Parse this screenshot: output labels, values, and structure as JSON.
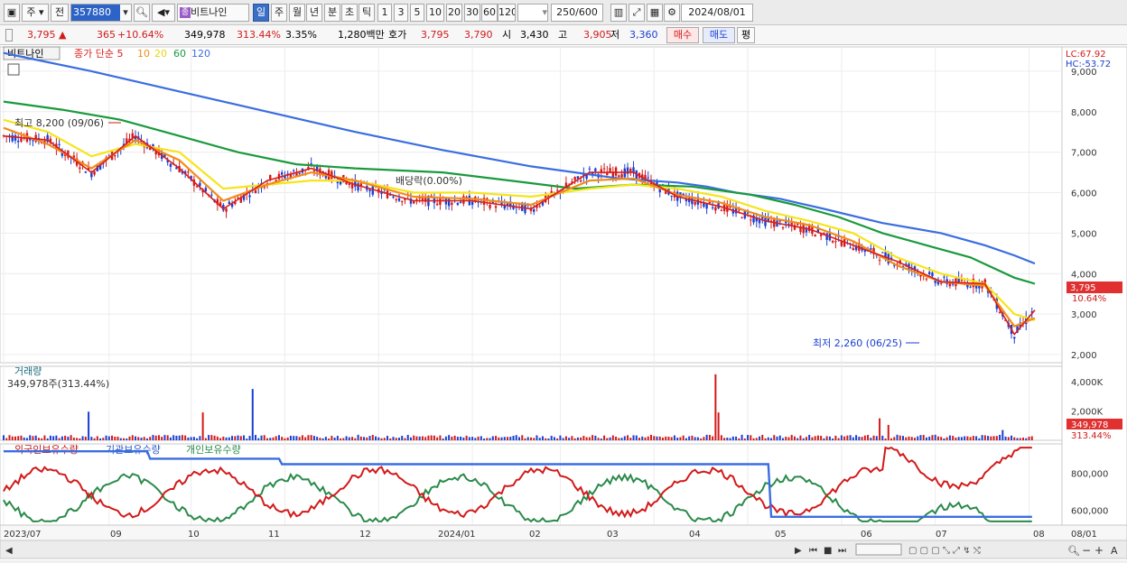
{
  "toolbar": {
    "type_label": "주",
    "period_label": "전",
    "stock_code": "357880",
    "stock_name": "비트나인",
    "tab_day": "일",
    "tab_week": "주",
    "tab_month": "월",
    "tab_year": "년",
    "tab_minute": "분",
    "tab_second": "초",
    "tab_tick": "틱",
    "intervals": [
      "1",
      "3",
      "5",
      "10",
      "20",
      "30",
      "60",
      "120"
    ],
    "count": "250",
    "count_max": "/600",
    "date": "2024/08/01"
  },
  "infobar": {
    "price": "3,795",
    "change": "365",
    "change_pct": "+10.64%",
    "volume": "349,978",
    "volume_ratio": "313.44%",
    "turnover": "3.35%",
    "amount": "1,280백만",
    "quote_label": "호가",
    "bid": "3,795",
    "ask": "3,790",
    "open_label": "시",
    "open": "3,430",
    "high_label": "고",
    "high": "3,905",
    "low_label": "저",
    "low": "3,360",
    "buy": "매수",
    "sell": "매도",
    "avg": "평"
  },
  "colors": {
    "ma5": "#d81e1e",
    "ma10": "#f28c1a",
    "ma20": "#f5e51a",
    "ma60": "#1a9a3c",
    "ma120": "#3a6ee0",
    "up": "#d21a1a",
    "down": "#1a3fd2"
  },
  "chart_data": [
    {
      "type": "candlestick",
      "title": "비트나인",
      "legend": [
        "종가 단순 5",
        "10",
        "20",
        "60",
        "120"
      ],
      "ylim": [
        1800,
        9600
      ],
      "yticks": [
        2000,
        3000,
        4000,
        5000,
        6000,
        7000,
        8000,
        9000
      ],
      "ytick_labels": [
        "2,000",
        "3,000",
        "4,000",
        "5,000",
        "6,000",
        "7,000",
        "8,000",
        "9,000"
      ],
      "lc": "LC:67.92",
      "hc": "HC:-53.72",
      "high_label": "최고 8,200 (09/06)",
      "low_label": "최저 2,260 (06/25)",
      "div_label": "배당락(0.00%)",
      "last_price": "3,795",
      "last_pct": "10.64%",
      "x_labels": [
        "2023/07",
        "09",
        "10",
        "11",
        "12",
        "2024/01",
        "02",
        "03",
        "04",
        "05",
        "06",
        "07",
        "08",
        "08/01"
      ],
      "ma120": [
        [
          0,
          9450
        ],
        [
          10,
          9300
        ],
        [
          30,
          9000
        ],
        [
          60,
          8500
        ],
        [
          90,
          8000
        ],
        [
          120,
          7500
        ],
        [
          150,
          7050
        ],
        [
          180,
          6650
        ],
        [
          210,
          6350
        ],
        [
          230,
          6250
        ],
        [
          240,
          6150
        ],
        [
          250,
          6000
        ],
        [
          265,
          5850
        ],
        [
          280,
          5600
        ],
        [
          300,
          5250
        ],
        [
          320,
          5000
        ],
        [
          335,
          4700
        ],
        [
          345,
          4450
        ],
        [
          352,
          4250
        ]
      ],
      "ma60": [
        [
          0,
          8250
        ],
        [
          20,
          8050
        ],
        [
          40,
          7800
        ],
        [
          60,
          7400
        ],
        [
          80,
          7000
        ],
        [
          100,
          6700
        ],
        [
          120,
          6600
        ],
        [
          150,
          6500
        ],
        [
          175,
          6280
        ],
        [
          195,
          6100
        ],
        [
          215,
          6200
        ],
        [
          235,
          6150
        ],
        [
          255,
          5950
        ],
        [
          270,
          5700
        ],
        [
          285,
          5400
        ],
        [
          300,
          5000
        ],
        [
          315,
          4700
        ],
        [
          330,
          4400
        ],
        [
          345,
          3900
        ],
        [
          352,
          3750
        ]
      ],
      "ma20": [
        [
          0,
          7800
        ],
        [
          15,
          7500
        ],
        [
          30,
          6900
        ],
        [
          45,
          7200
        ],
        [
          60,
          7000
        ],
        [
          75,
          6100
        ],
        [
          90,
          6200
        ],
        [
          105,
          6300
        ],
        [
          120,
          6300
        ],
        [
          140,
          6000
        ],
        [
          160,
          6000
        ],
        [
          180,
          5900
        ],
        [
          200,
          6100
        ],
        [
          215,
          6200
        ],
        [
          230,
          6100
        ],
        [
          245,
          5900
        ],
        [
          260,
          5550
        ],
        [
          275,
          5300
        ],
        [
          290,
          5000
        ],
        [
          305,
          4400
        ],
        [
          320,
          4000
        ],
        [
          335,
          3750
        ],
        [
          345,
          3000
        ],
        [
          352,
          2850
        ]
      ],
      "ma10": [
        [
          0,
          7600
        ],
        [
          15,
          7200
        ],
        [
          30,
          6600
        ],
        [
          45,
          7300
        ],
        [
          60,
          6800
        ],
        [
          75,
          5800
        ],
        [
          90,
          6200
        ],
        [
          105,
          6500
        ],
        [
          120,
          6300
        ],
        [
          140,
          5900
        ],
        [
          160,
          5850
        ],
        [
          180,
          5700
        ],
        [
          200,
          6300
        ],
        [
          215,
          6350
        ],
        [
          230,
          5950
        ],
        [
          245,
          5750
        ],
        [
          260,
          5400
        ],
        [
          275,
          5200
        ],
        [
          290,
          4800
        ],
        [
          305,
          4200
        ],
        [
          320,
          3800
        ],
        [
          335,
          3700
        ],
        [
          345,
          2700
        ],
        [
          352,
          2900
        ]
      ],
      "ma5": [
        [
          0,
          7400
        ],
        [
          15,
          7300
        ],
        [
          30,
          6500
        ],
        [
          45,
          7400
        ],
        [
          60,
          6600
        ],
        [
          75,
          5600
        ],
        [
          90,
          6300
        ],
        [
          105,
          6600
        ],
        [
          120,
          6200
        ],
        [
          140,
          5800
        ],
        [
          160,
          5800
        ],
        [
          180,
          5600
        ],
        [
          200,
          6500
        ],
        [
          215,
          6500
        ],
        [
          230,
          5900
        ],
        [
          245,
          5650
        ],
        [
          260,
          5300
        ],
        [
          275,
          5100
        ],
        [
          290,
          4700
        ],
        [
          305,
          4300
        ],
        [
          320,
          3800
        ],
        [
          335,
          3750
        ],
        [
          345,
          2500
        ],
        [
          352,
          3100
        ]
      ]
    },
    {
      "type": "bar",
      "title": "거래량",
      "subtitle": "349,978주(313.44%)",
      "yticks": [
        2000,
        4000
      ],
      "ytick_labels": [
        "2,000K",
        "4,000K"
      ],
      "last_value": "349,978",
      "last_pct": "313.44%",
      "ylim": [
        0,
        4800
      ],
      "spikes": [
        [
          38,
          1950
        ],
        [
          72,
          1200
        ],
        [
          90,
          1900
        ],
        [
          112,
          3500
        ],
        [
          180,
          1500
        ],
        [
          320,
          4500
        ],
        [
          322,
          1900
        ],
        [
          394,
          1500
        ],
        [
          398,
          1050
        ],
        [
          425,
          1350
        ],
        [
          450,
          700
        ],
        [
          462,
          820
        ]
      ]
    },
    {
      "type": "line",
      "title": "외국인보유수량",
      "legend": [
        "외국인보유수량",
        "기관보유수량",
        "개인보유수량"
      ],
      "yticks": [
        600000,
        800000
      ],
      "ytick_labels": [
        "600,000",
        "800,000"
      ],
      "ylim": [
        520000,
        960000
      ]
    }
  ]
}
